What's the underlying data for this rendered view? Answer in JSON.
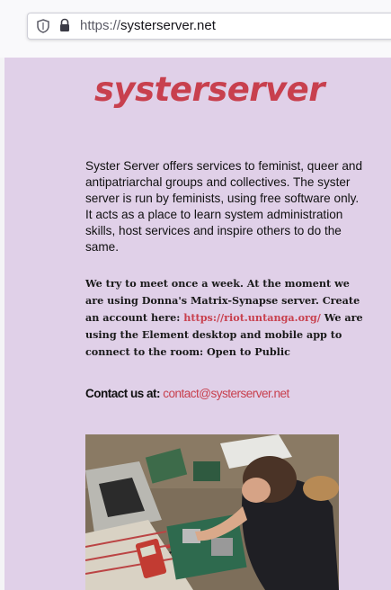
{
  "browser": {
    "url_scheme": "https://",
    "url_host": "systerserver.net",
    "icons": [
      "shield-icon",
      "lock-icon"
    ]
  },
  "site": {
    "logo_text": "systerserver",
    "intro": "Syster Server offers services to feminist, queer and antipatriarchal groups and collectives. The syster server is run by feminists, using free software only. It acts as a place to learn system administration skills, host services and inspire others to do the same.",
    "meet_text_1": "We try to meet once a week. At the moment we are using Donna's Matrix-Synapse server. Create an account here: ",
    "meet_link": "https://riot.untanga.org/",
    "meet_text_2": " We are using the Element desktop and mobile app to connect to the room: Open to Public",
    "contact_label": "Contact us at: ",
    "contact_email": "contact@systerserver.net",
    "photo_subject": "Person working on an open computer circuit board at a workbench"
  },
  "colors": {
    "page_background": "#e0d0e8",
    "accent": "#c8404e",
    "text": "#111111"
  }
}
